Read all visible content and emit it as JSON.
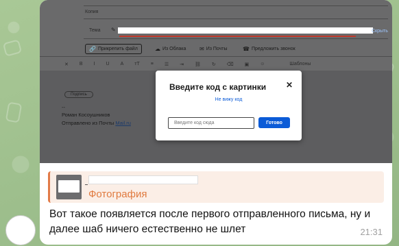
{
  "screenshot": {
    "fields": {
      "copy_label": "Копия",
      "subject_label": "Тема",
      "hide_link": "Скрыть"
    },
    "toolbar": {
      "attach_label": "Прикрепить файл",
      "cloud_label": "Из Облака",
      "mail_label": "Из Почты",
      "call_label": "Предложить звонок",
      "templates_label": "Шаблоны"
    },
    "signature": {
      "pill_label": "Подпись",
      "dashes": "--",
      "name": "Роман Косоушников",
      "sent_from_prefix": "Отправлено из Почты ",
      "sent_from_link": "Mail.ru"
    },
    "modal": {
      "title": "Введите код с картинки",
      "cant_see_link": "Не вижу код",
      "input_placeholder": "Введите код сюда",
      "submit_label": "Готово"
    }
  },
  "reply": {
    "type_label": "Фотография"
  },
  "message": {
    "text": "Вот такое появляется после первого отправленного письма, ну и далее шаб ничего естественно не шлет",
    "time": "21:31"
  },
  "colors": {
    "accent_orange": "#e07a3f",
    "mail_blue": "#0b5bd7"
  }
}
